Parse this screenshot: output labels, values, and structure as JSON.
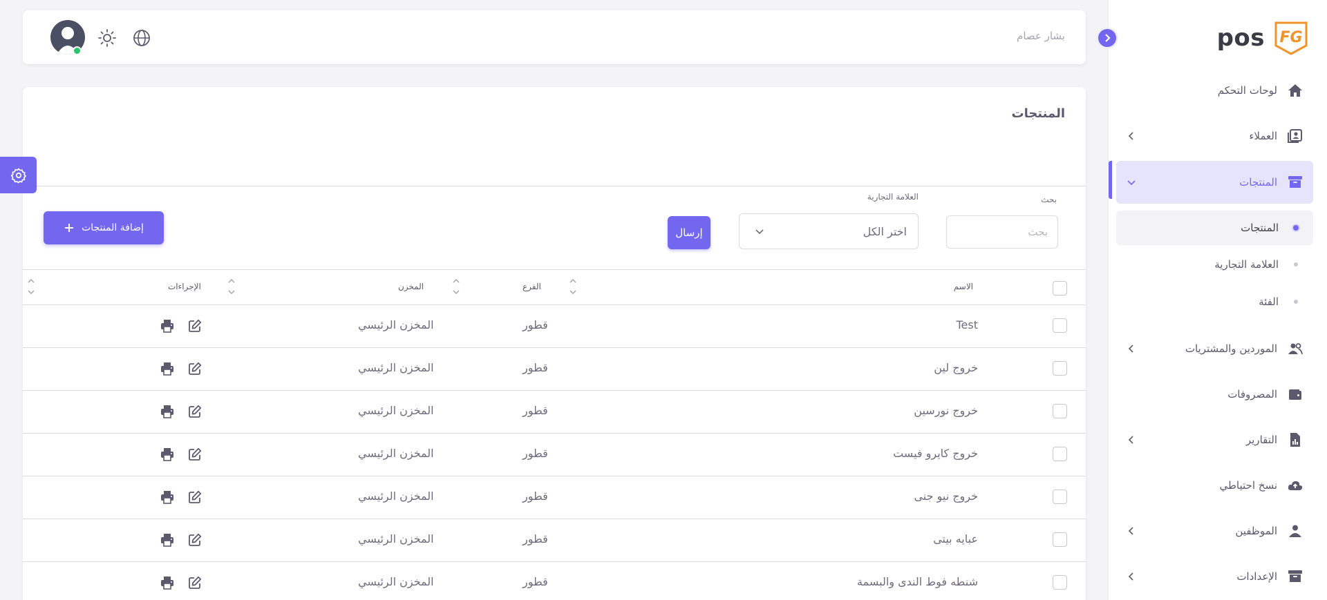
{
  "sidebar": {
    "brand": "pos",
    "brand_mark_letters": "FG",
    "items": [
      {
        "label": "لوحات التحكم",
        "icon": "home-icon"
      },
      {
        "label": "العملاء",
        "icon": "contacts-icon"
      },
      {
        "label": "المنتجات",
        "icon": "archive-icon"
      },
      {
        "label": "الموردين والمشتريات",
        "icon": "users-icon"
      },
      {
        "label": "المصروفات",
        "icon": "wallet-icon"
      },
      {
        "label": "التقارير",
        "icon": "report-icon"
      },
      {
        "label": "نسخ احتياطي",
        "icon": "cloud-upload-icon"
      },
      {
        "label": "الموظفين",
        "icon": "user-icon"
      },
      {
        "label": "الإعدادات",
        "icon": "settings-archive-icon"
      }
    ],
    "sub_items": [
      {
        "label": "المنتجات"
      },
      {
        "label": "العلامة التجارية"
      },
      {
        "label": "الفئة"
      }
    ]
  },
  "topbar": {
    "username": "بشار عصام"
  },
  "page": {
    "title": "المنتجات",
    "search_label": "بحث",
    "search_placeholder": "بحث",
    "brand_label": "العلامة التجارية",
    "brand_value": "اختر الكل",
    "send_label": "إرسال",
    "add_label": "إضافة المنتجات"
  },
  "table": {
    "columns": [
      "الاسم",
      "الفرع",
      "المخزن",
      "الإجراءات"
    ],
    "rows": [
      {
        "name": "Test",
        "branch": "قطور",
        "store": "المخزن الرئيسي"
      },
      {
        "name": "خروج لين",
        "branch": "قطور",
        "store": "المخزن الرئيسي"
      },
      {
        "name": "خروج نورسين",
        "branch": "قطور",
        "store": "المخزن الرئيسي"
      },
      {
        "name": "خروج كايرو فيست",
        "branch": "قطور",
        "store": "المخزن الرئيسي"
      },
      {
        "name": "خروج نيو جنى",
        "branch": "قطور",
        "store": "المخزن الرئيسي"
      },
      {
        "name": "عبايه بيتى",
        "branch": "قطور",
        "store": "المخزن الرئيسي"
      },
      {
        "name": "شنطه فوط الندى والبسمة",
        "branch": "قطور",
        "store": "المخزن الرئيسي"
      }
    ]
  },
  "colors": {
    "accent": "#7367f0",
    "accent_light": "#e6e3fd",
    "brand_orange": "#f0932b",
    "online": "#28c76f"
  }
}
